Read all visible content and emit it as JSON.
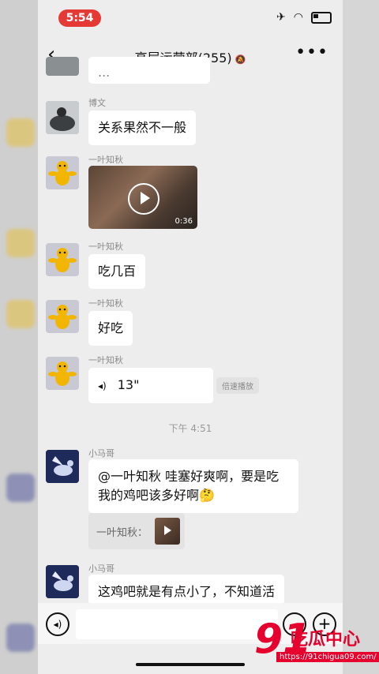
{
  "status": {
    "time": "5:54",
    "airplane": "✈",
    "wifi": "wifi-icon",
    "battery": "battery-icon"
  },
  "nav": {
    "back_icon": "‹",
    "title": "高层运营部(255)",
    "mute_icon": "🔕",
    "more_icon": "•••"
  },
  "messages": [
    {
      "sender": "",
      "text": "...",
      "avatar": "dark"
    },
    {
      "sender": "博文",
      "text": "关系果然不一般",
      "avatar": "dark"
    },
    {
      "sender": "一叶知秋",
      "video_duration": "0:36",
      "avatar": "yellow"
    },
    {
      "sender": "一叶知秋",
      "text": "吃几百",
      "avatar": "yellow"
    },
    {
      "sender": "一叶知秋",
      "text": "好吃",
      "avatar": "yellow"
    },
    {
      "sender": "一叶知秋",
      "voice_length": "13\"",
      "speed_label": "倍速播放",
      "avatar": "yellow"
    },
    {
      "timestamp": "下午 4:51"
    },
    {
      "sender": "小马哥",
      "text_line1": "@一叶知秋 哇塞好爽啊，要是吃",
      "text_line2": "我的鸡吧该多好啊🤔",
      "quote_label": "一叶知秋：",
      "avatar": "blue"
    },
    {
      "sender": "小马哥",
      "text": "这鸡吧就是有点小了，不知道活",
      "avatar": "blue"
    }
  ],
  "input": {
    "placeholder": ""
  },
  "watermark": {
    "number": "91",
    "text": "吃瓜中心",
    "url": "https://91chigua09.com/"
  },
  "colors": {
    "accent": "#e53935",
    "watermark": "#e6002d",
    "chat_bg": "#ededed"
  }
}
